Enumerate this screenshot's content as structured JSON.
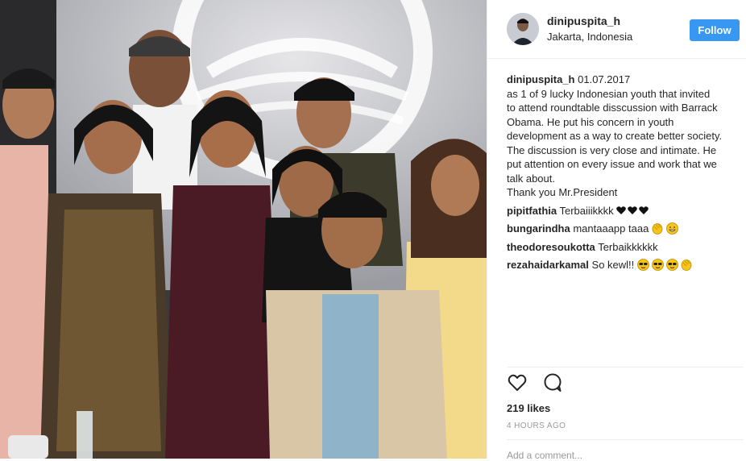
{
  "post": {
    "username": "dinipuspita_h",
    "location": "Jakarta, Indonesia",
    "follow_label": "Follow",
    "caption": {
      "username": "dinipuspita_h",
      "date": "01.07.2017",
      "lines": [
        "as 1 of 9 lucky Indonesian youth that invited",
        "to attend roundtable disscussion with Barrack",
        "Obama. He put his concern in youth",
        "development as a way to create better society.",
        "The discussion is very close and intimate. He",
        "put attention on every issue and work that we",
        "talk about.",
        "Thank you Mr.President"
      ]
    },
    "comments": [
      {
        "user": "pipitfathia",
        "text": "Terbaiiikkkk",
        "emoji": [
          "black-heart",
          "black-heart",
          "black-heart"
        ]
      },
      {
        "user": "bungarindha",
        "text": "mantaaapp taaa",
        "emoji": [
          "clapping-hands",
          "grinning-face"
        ]
      },
      {
        "user": "theodoresoukotta",
        "text": "Terbaikkkkkk",
        "emoji": []
      },
      {
        "user": "rezahaidarkamal",
        "text": "So kewl!!",
        "emoji": [
          "sunglasses-face",
          "sunglasses-face",
          "sunglasses-face",
          "clapping-hands"
        ]
      }
    ],
    "likes": "219 likes",
    "time": "4 HOURS AGO",
    "add_comment_placeholder": "Add a comment..."
  },
  "icons": {
    "like": "heart-outline-icon",
    "comment": "comment-bubble-icon"
  },
  "colors": {
    "follow_button": "#3897f0",
    "text": "#262626",
    "muted": "#999999",
    "divider": "#efefef",
    "emoji_yellow": "#f5c518"
  }
}
